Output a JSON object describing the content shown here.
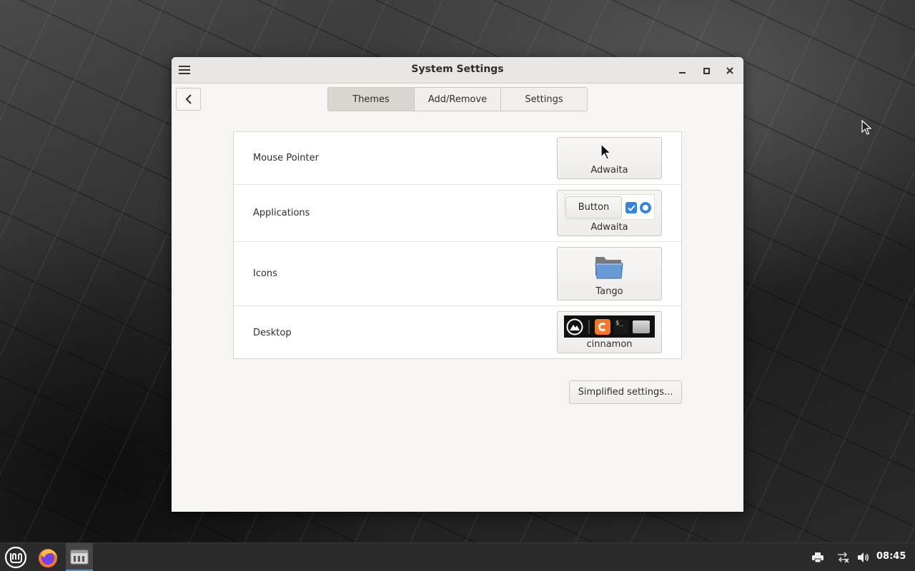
{
  "window": {
    "title": "System Settings"
  },
  "tabs": [
    {
      "label": "Themes",
      "active": true
    },
    {
      "label": "Add/Remove",
      "active": false
    },
    {
      "label": "Settings",
      "active": false
    }
  ],
  "themes": {
    "rows": [
      {
        "label": "Mouse Pointer",
        "value": "Adwaita"
      },
      {
        "label": "Applications",
        "value": "Adwaita",
        "preview_button": "Button"
      },
      {
        "label": "Icons",
        "value": "Tango"
      },
      {
        "label": "Desktop",
        "value": "cinnamon"
      }
    ]
  },
  "simplified_button": "Simplified settings...",
  "taskbar": {
    "clock": "08:45"
  },
  "colors": {
    "accent": "#4f8fcf",
    "folder_blue": "#6a9ad6",
    "checkbox_blue": "#3584e4",
    "firefox_orange": "#f4772b",
    "taskbar_bg": "#2b2b2b"
  }
}
